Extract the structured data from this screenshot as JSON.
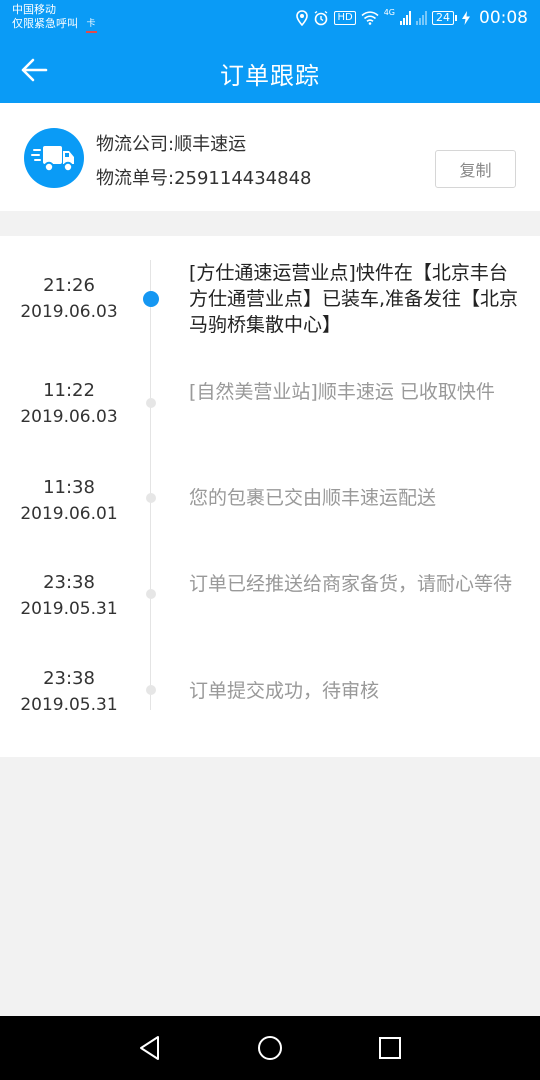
{
  "status_bar": {
    "carrier_line1": "中国移动",
    "carrier_line2": "仅限紧急呼叫",
    "hd_label": "HD",
    "net_label": "4G",
    "battery": "24",
    "time": "00:08"
  },
  "app_bar": {
    "title": "订单跟踪"
  },
  "carrier_info": {
    "company": "物流公司:顺丰速运",
    "tracking_no": "物流单号:259114434848",
    "copy_label": "复制"
  },
  "events": [
    {
      "time": "21:26",
      "date": "2019.06.03",
      "text": "[方仕通速运营业点]快件在【北京丰台方仕通营业点】已装车,准备发往【北京马驹桥集散中心】",
      "active": true
    },
    {
      "time": "11:22",
      "date": "2019.06.03",
      "text": "[自然美营业站]顺丰速运 已收取快件",
      "active": false
    },
    {
      "time": "11:38",
      "date": "2019.06.01",
      "text": "您的包裹已交由顺丰速运配送",
      "active": false
    },
    {
      "time": "23:38",
      "date": "2019.05.31",
      "text": "订单已经推送给商家备货，请耐心等待",
      "active": false
    },
    {
      "time": "23:38",
      "date": "2019.05.31",
      "text": "订单提交成功，待审核",
      "active": false
    }
  ],
  "colors": {
    "primary": "#0a9bf6",
    "timeline_active": "#1597f2",
    "timeline_inactive": "#e6e6e6",
    "page_bg": "#f2f2f2"
  },
  "icons": {
    "back": "arrow-left-icon",
    "truck": "truck-icon",
    "nav_back": "triangle-back-icon",
    "nav_home": "circle-home-icon",
    "nav_recent": "square-recent-icon"
  }
}
